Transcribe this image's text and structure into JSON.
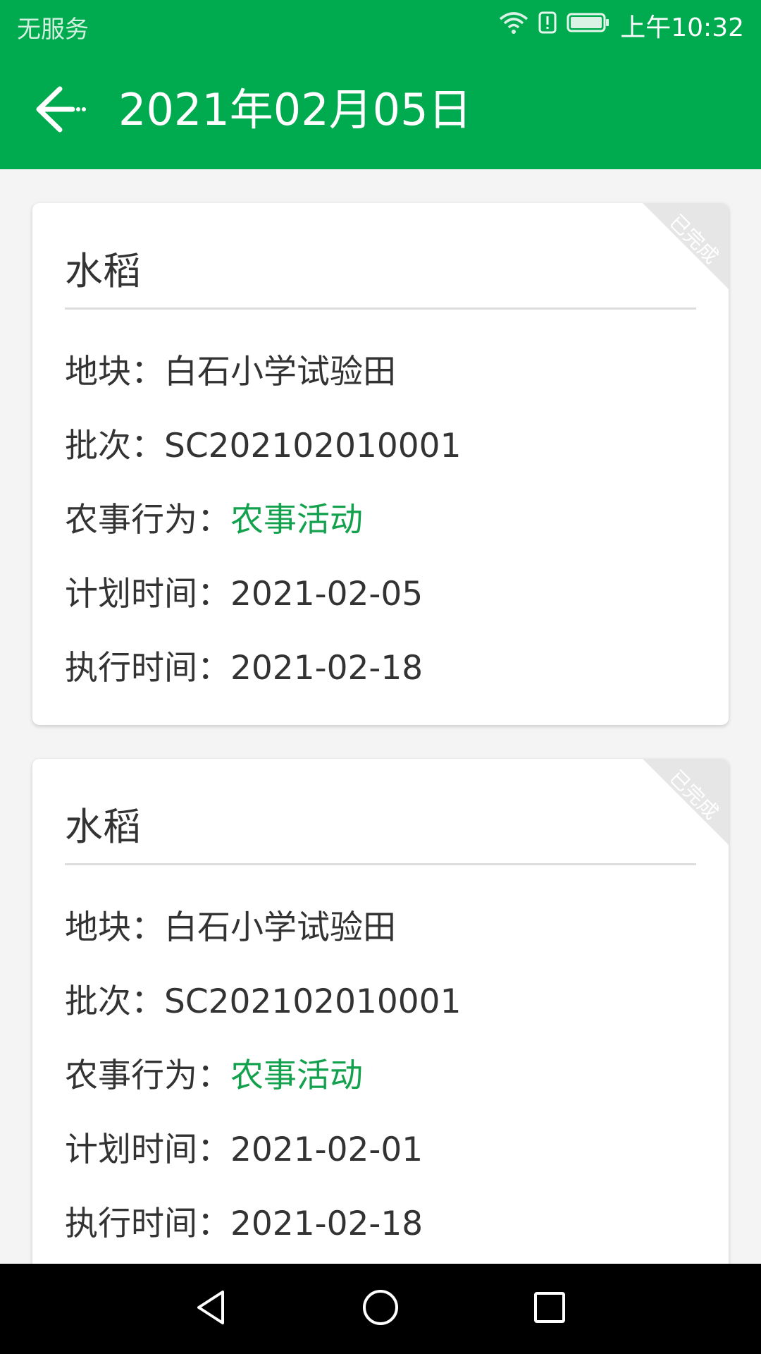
{
  "status_bar": {
    "carrier": "无服务",
    "time": "上午10:32",
    "icons": [
      "wifi-icon",
      "alert-icon",
      "battery-icon"
    ]
  },
  "app_bar": {
    "title": "2021年02月05日",
    "back_icon": "back-arrow-icon"
  },
  "colors": {
    "primary": "#00aa4f",
    "accent_text": "#14a14d",
    "text": "#333333"
  },
  "records": [
    {
      "title": "水稻",
      "badge": "已完成",
      "plot_label": "地块：",
      "plot": "白石小学试验田",
      "batch_label": "批次：",
      "batch": "SC202102010001",
      "activity_label": "农事行为：",
      "activity": "农事活动",
      "planned_label": "计划时间：",
      "planned": "2021-02-05",
      "executed_label": "执行时间：",
      "executed": "2021-02-18"
    },
    {
      "title": "水稻",
      "badge": "已完成",
      "plot_label": "地块：",
      "plot": "白石小学试验田",
      "batch_label": "批次：",
      "batch": "SC202102010001",
      "activity_label": "农事行为：",
      "activity": "农事活动",
      "planned_label": "计划时间：",
      "planned": "2021-02-01",
      "executed_label": "执行时间：",
      "executed": "2021-02-18"
    }
  ],
  "nav_bar": {
    "icons": [
      "back-triangle-icon",
      "home-circle-icon",
      "recents-square-icon"
    ]
  }
}
